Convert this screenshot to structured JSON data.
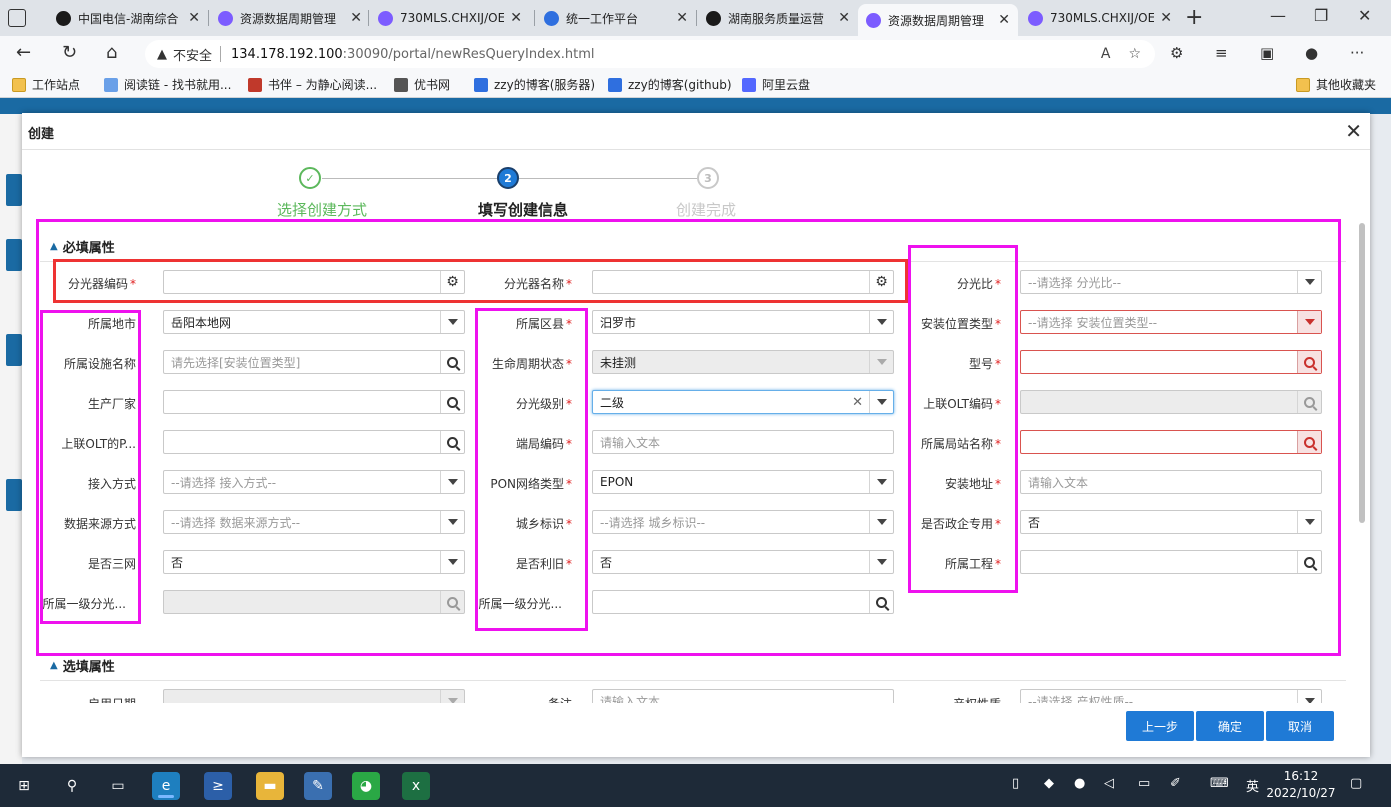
{
  "browser": {
    "tabs": [
      {
        "title": "中国电信-湖南综合",
        "favicon": "ie-icon",
        "active": false
      },
      {
        "title": "资源数据周期管理",
        "favicon": "app-icon",
        "active": false
      },
      {
        "title": "730MLS.CHXIJ/OE",
        "favicon": "app-icon",
        "active": false
      },
      {
        "title": "统一工作平台",
        "favicon": "z-icon",
        "active": false
      },
      {
        "title": "湖南服务质量运营",
        "favicon": "ie-icon",
        "active": false
      },
      {
        "title": "资源数据周期管理",
        "favicon": "app-icon",
        "active": true
      },
      {
        "title": "730MLS.CHXIJ/OE",
        "favicon": "app-icon",
        "active": false
      }
    ],
    "address": {
      "security_label": "不安全",
      "host": "134.178.192.100",
      "path": ":30090/portal/newResQueryIndex.html"
    },
    "bookmarks": [
      {
        "label": "工作站点",
        "icon": "folder-icon"
      },
      {
        "label": "阅读链 - 找书就用...",
        "icon": "link-icon"
      },
      {
        "label": "书伴 – 为静心阅读...",
        "icon": "book-icon"
      },
      {
        "label": "优书网",
        "icon": "diamond-icon"
      },
      {
        "label": "zzy的博客(服务器)",
        "icon": "z-icon"
      },
      {
        "label": "zzy的博客(github)",
        "icon": "z-icon"
      },
      {
        "label": "阿里云盘",
        "icon": "cloud-icon"
      }
    ],
    "other_bookmarks": "其他收藏夹"
  },
  "modal": {
    "title": "创建",
    "steps": [
      {
        "label": "选择创建方式",
        "number": "✓",
        "state": "done"
      },
      {
        "label": "填写创建信息",
        "number": "2",
        "state": "current"
      },
      {
        "label": "创建完成",
        "number": "3",
        "state": "todo"
      }
    ],
    "required_section": "必填属性",
    "optional_section": "选填属性",
    "fields": {
      "c1": [
        {
          "label": "分光器编码",
          "req": true,
          "value": "",
          "placeholder": "",
          "kind": "gear"
        },
        {
          "label": "所属地市",
          "req": false,
          "value": "岳阳本地网",
          "placeholder": "",
          "kind": "select"
        },
        {
          "label": "所属设施名称",
          "req": false,
          "value": "",
          "placeholder": "请先选择[安装位置类型]",
          "kind": "search"
        },
        {
          "label": "生产厂家",
          "req": false,
          "value": "",
          "placeholder": "",
          "kind": "search"
        },
        {
          "label": "上联OLT的P...",
          "req": false,
          "value": "",
          "placeholder": "",
          "kind": "search"
        },
        {
          "label": "接入方式",
          "req": false,
          "value": "",
          "placeholder": "--请选择 接入方式--",
          "kind": "select"
        },
        {
          "label": "数据来源方式",
          "req": false,
          "value": "",
          "placeholder": "--请选择 数据来源方式--",
          "kind": "select"
        },
        {
          "label": "是否三网",
          "req": false,
          "value": "否",
          "placeholder": "",
          "kind": "select"
        },
        {
          "label": "所属一级分光...",
          "req": false,
          "value": "",
          "placeholder": "",
          "kind": "search-dis"
        }
      ],
      "c2": [
        {
          "label": "分光器名称",
          "req": true,
          "value": "",
          "placeholder": "",
          "kind": "gear"
        },
        {
          "label": "所属区县",
          "req": true,
          "value": "汨罗市",
          "placeholder": "",
          "kind": "select"
        },
        {
          "label": "生命周期状态",
          "req": true,
          "value": "未挂测",
          "placeholder": "",
          "kind": "select-dis"
        },
        {
          "label": "分光级别",
          "req": true,
          "value": "二级",
          "placeholder": "",
          "kind": "select-focus"
        },
        {
          "label": "端局编码",
          "req": true,
          "value": "",
          "placeholder": "请输入文本",
          "kind": "text"
        },
        {
          "label": "PON网络类型",
          "req": true,
          "value": "EPON",
          "placeholder": "",
          "kind": "select"
        },
        {
          "label": "城乡标识",
          "req": true,
          "value": "",
          "placeholder": "--请选择 城乡标识--",
          "kind": "select"
        },
        {
          "label": "是否利旧",
          "req": true,
          "value": "否",
          "placeholder": "",
          "kind": "select"
        },
        {
          "label": "所属一级分光...",
          "req": false,
          "value": "",
          "placeholder": "",
          "kind": "search"
        }
      ],
      "c3": [
        {
          "label": "分光比",
          "req": true,
          "value": "",
          "placeholder": "--请选择 分光比--",
          "kind": "select"
        },
        {
          "label": "安装位置类型",
          "req": true,
          "value": "",
          "placeholder": "--请选择 安装位置类型--",
          "kind": "select-err"
        },
        {
          "label": "型号",
          "req": true,
          "value": "",
          "placeholder": "",
          "kind": "search-err"
        },
        {
          "label": "上联OLT编码",
          "req": true,
          "value": "",
          "placeholder": "",
          "kind": "search-dis"
        },
        {
          "label": "所属局站名称",
          "req": true,
          "value": "",
          "placeholder": "",
          "kind": "search-err"
        },
        {
          "label": "安装地址",
          "req": true,
          "value": "",
          "placeholder": "请输入文本",
          "kind": "text"
        },
        {
          "label": "是否政企专用",
          "req": true,
          "value": "否",
          "placeholder": "",
          "kind": "select"
        },
        {
          "label": "所属工程",
          "req": true,
          "value": "",
          "placeholder": "",
          "kind": "search"
        }
      ],
      "optional": [
        {
          "label": "启用日期",
          "placeholder": ""
        },
        {
          "label": "备注",
          "placeholder": "请输入文本"
        },
        {
          "label": "产权性质",
          "placeholder": "--请选择 产权性质--"
        }
      ]
    },
    "buttons": {
      "prev": "上一步",
      "confirm": "确定",
      "cancel": "取消"
    }
  },
  "taskbar": {
    "time": "16:12",
    "date": "2022/10/27",
    "ime": "英"
  }
}
